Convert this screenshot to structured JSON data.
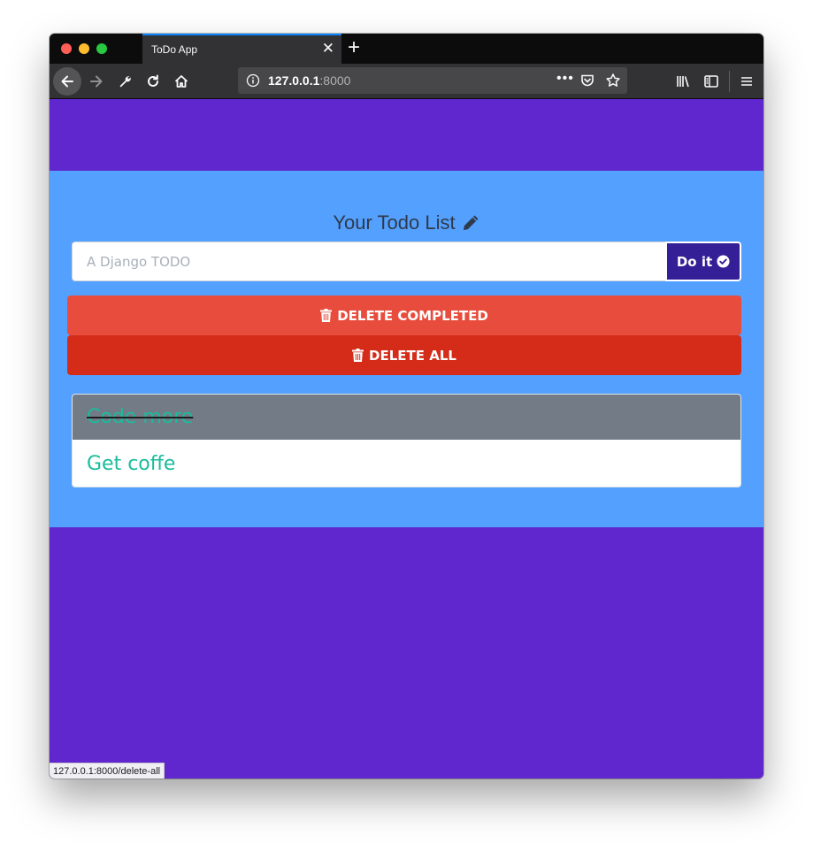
{
  "browser": {
    "tab_title": "ToDo App",
    "url_host": "127.0.0.1",
    "url_port": ":8000",
    "status_url": "127.0.0.1:8000/delete-all"
  },
  "app": {
    "heading": "Your Todo List",
    "input_placeholder": "A Django TODO",
    "doit_label": "Do it",
    "delete_completed_label": "DELETE COMPLETED",
    "delete_all_label": "DELETE ALL",
    "todos": [
      {
        "text": "Code more",
        "completed": true
      },
      {
        "text": "Get coffe",
        "completed": false
      }
    ]
  },
  "colors": {
    "page_bg": "#5f27cd",
    "band_bg": "#54a0ff",
    "delete_completed": "#e74c3c",
    "delete_all": "#d52b19",
    "doit": "#341f97",
    "todo_text": "#1abc9c"
  }
}
